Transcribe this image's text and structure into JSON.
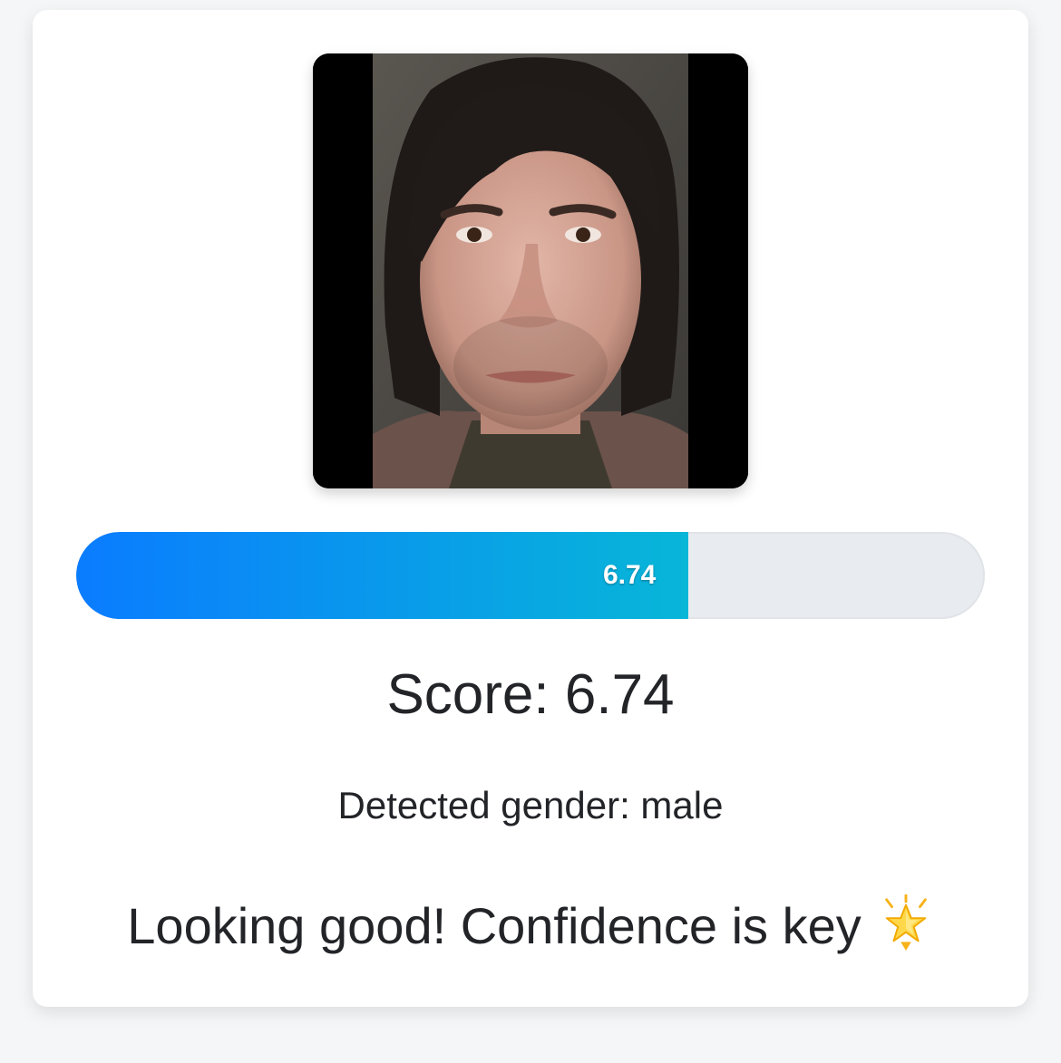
{
  "progress": {
    "value": 6.74,
    "max": 10,
    "label": "6.74"
  },
  "score_text": "Score: 6.74",
  "gender_text": "Detected gender: male",
  "message": {
    "text": "Looking good! Confidence is key",
    "icon": "star-icon"
  },
  "colors": {
    "progress_start": "#0a7cff",
    "progress_end": "#08b6d8",
    "track": "#e8ebef"
  }
}
